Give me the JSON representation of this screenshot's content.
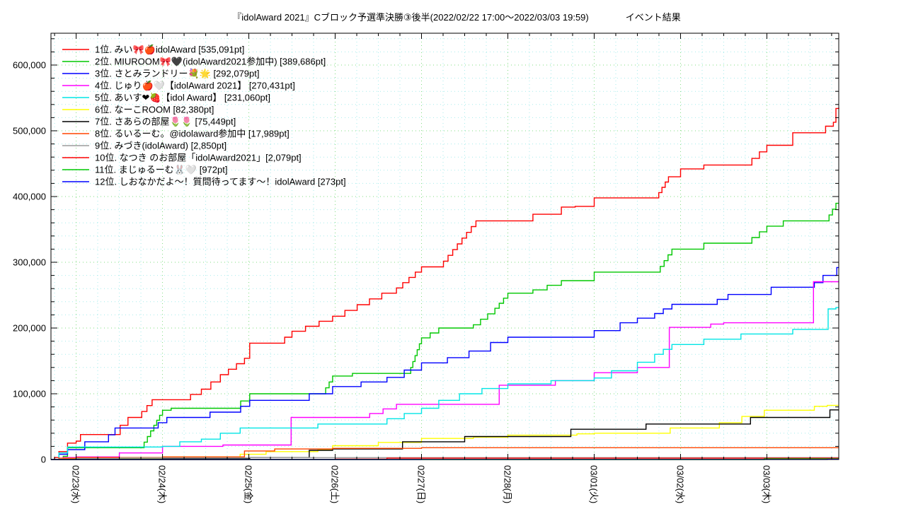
{
  "title": "『idolAward 2021』Cブロック予選準決勝③後半(2022/02/22 17:00～2022/03/03 19:59)　　　　イベント結果",
  "chart_data": {
    "type": "line",
    "title": "『idolAward 2021』Cブロック予選準決勝③後半(2022/02/22 17:00～2022/03/03 19:59) イベント結果",
    "xlabel": "",
    "ylabel": "",
    "legend_position": "upper-left-inside",
    "grid": {
      "major_color": "#82dc82",
      "minor_color": "#a6ebeb",
      "style": "dotted"
    },
    "x_axis": {
      "unit": "days_from_2022-02-22",
      "start_day": 0.7083,
      "end_day": 9.8326,
      "minor_step_days": 0.25,
      "ticks": [
        {
          "day": 1,
          "label": "02/23(水)"
        },
        {
          "day": 2,
          "label": "02/24(木)"
        },
        {
          "day": 3,
          "label": "02/25(金)"
        },
        {
          "day": 4,
          "label": "02/26(土)"
        },
        {
          "day": 5,
          "label": "02/27(日)"
        },
        {
          "day": 6,
          "label": "02/28(月)"
        },
        {
          "day": 7,
          "label": "03/01(火)"
        },
        {
          "day": 8,
          "label": "03/02(水)"
        },
        {
          "day": 9,
          "label": "03/03(木)"
        }
      ]
    },
    "y_axis": {
      "min": 0,
      "max": 600000,
      "major_step": 100000,
      "minor_step": 20000,
      "tick_labels": [
        "0",
        "100,000",
        "200,000",
        "300,000",
        "400,000",
        "500,000",
        "600,000"
      ]
    },
    "series": [
      {
        "rank": 1,
        "label": " 1位. みい🎀🍎idolAward [535,091pt]",
        "final_pt": 535091,
        "color": "#ff0000",
        "points": [
          [
            0.708,
            0
          ],
          [
            0.75,
            3000
          ],
          [
            0.8,
            12000
          ],
          [
            0.9,
            25000
          ],
          [
            1.0,
            28000
          ],
          [
            1.05,
            38000
          ],
          [
            1.45,
            38000
          ],
          [
            1.51,
            52000
          ],
          [
            1.6,
            64000
          ],
          [
            1.7,
            64000
          ],
          [
            1.88,
            91000
          ],
          [
            2.2,
            91000
          ],
          [
            2.45,
            107000
          ],
          [
            2.67,
            129000
          ],
          [
            2.95,
            154000
          ],
          [
            3.01,
            177000
          ],
          [
            3.33,
            177000
          ],
          [
            3.5,
            195000
          ],
          [
            3.97,
            218000
          ],
          [
            4.54,
            253000
          ],
          [
            4.71,
            261000
          ],
          [
            5.0,
            293000
          ],
          [
            5.2,
            293000
          ],
          [
            5.63,
            363000
          ],
          [
            6.13,
            363000
          ],
          [
            6.29,
            373000
          ],
          [
            6.62,
            384000
          ],
          [
            6.78,
            385000
          ],
          [
            7.0,
            398000
          ],
          [
            7.71,
            398000
          ],
          [
            7.86,
            430000
          ],
          [
            8.0,
            442000
          ],
          [
            8.27,
            448000
          ],
          [
            8.74,
            448000
          ],
          [
            9.0,
            478000
          ],
          [
            9.27,
            478000
          ],
          [
            9.3,
            497000
          ],
          [
            9.65,
            497000
          ],
          [
            9.68,
            507000
          ],
          [
            9.77,
            513000
          ],
          [
            9.8,
            534000
          ],
          [
            9.8326,
            535091
          ]
        ]
      },
      {
        "rank": 2,
        "label": " 2位. MIUROOM🎀🖤(idolAward2021参加中) [389,686pt]",
        "final_pt": 389686,
        "color": "#00c800",
        "points": [
          [
            0.708,
            0
          ],
          [
            0.85,
            5000
          ],
          [
            0.9,
            18000
          ],
          [
            1.75,
            18000
          ],
          [
            1.9,
            52000
          ],
          [
            2.0,
            75000
          ],
          [
            2.1,
            78000
          ],
          [
            2.8,
            78000
          ],
          [
            3.01,
            100000
          ],
          [
            3.85,
            100000
          ],
          [
            3.97,
            127000
          ],
          [
            4.2,
            131000
          ],
          [
            4.85,
            131000
          ],
          [
            5.0,
            185000
          ],
          [
            5.2,
            200000
          ],
          [
            5.6,
            205000
          ],
          [
            5.85,
            230000
          ],
          [
            6.0,
            253000
          ],
          [
            6.29,
            258000
          ],
          [
            6.62,
            272000
          ],
          [
            7.0,
            285000
          ],
          [
            7.72,
            285000
          ],
          [
            7.9,
            320000
          ],
          [
            8.27,
            329000
          ],
          [
            8.74,
            329000
          ],
          [
            9.0,
            355000
          ],
          [
            9.19,
            363000
          ],
          [
            9.68,
            363000
          ],
          [
            9.8,
            389686
          ],
          [
            9.8326,
            389686
          ]
        ]
      },
      {
        "rank": 3,
        "label": " 3位. さとみランドリー💐🌟 [292,079pt]",
        "final_pt": 292079,
        "color": "#0000ff",
        "points": [
          [
            0.708,
            0
          ],
          [
            0.8,
            8000
          ],
          [
            0.9,
            15000
          ],
          [
            1.05,
            15000
          ],
          [
            1.1,
            27000
          ],
          [
            1.3,
            27000
          ],
          [
            1.45,
            48000
          ],
          [
            1.85,
            48000
          ],
          [
            2.05,
            64000
          ],
          [
            2.4,
            64000
          ],
          [
            2.55,
            72000
          ],
          [
            2.8,
            72000
          ],
          [
            3.01,
            90000
          ],
          [
            3.5,
            90000
          ],
          [
            3.7,
            100000
          ],
          [
            3.97,
            111000
          ],
          [
            4.3,
            118000
          ],
          [
            4.6,
            125000
          ],
          [
            5.0,
            147000
          ],
          [
            5.3,
            155000
          ],
          [
            5.55,
            165000
          ],
          [
            5.8,
            178000
          ],
          [
            6.0,
            186000
          ],
          [
            6.6,
            186000
          ],
          [
            7.0,
            196000
          ],
          [
            7.3,
            208000
          ],
          [
            7.7,
            222000
          ],
          [
            7.9,
            236000
          ],
          [
            8.3,
            236000
          ],
          [
            8.55,
            251000
          ],
          [
            8.9,
            251000
          ],
          [
            9.05,
            262000
          ],
          [
            9.45,
            262000
          ],
          [
            9.55,
            269000
          ],
          [
            9.65,
            280000
          ],
          [
            9.78,
            280000
          ],
          [
            9.81,
            292079
          ],
          [
            9.8326,
            292079
          ]
        ]
      },
      {
        "rank": 4,
        "label": " 4位. じゅり🍎🤍【idolAward 2021】 [270,431pt]",
        "final_pt": 270431,
        "color": "#ff00ff",
        "points": [
          [
            0.708,
            0
          ],
          [
            0.85,
            3000
          ],
          [
            1.0,
            4000
          ],
          [
            1.3,
            4000
          ],
          [
            1.5,
            10000
          ],
          [
            1.95,
            10000
          ],
          [
            2.0,
            20000
          ],
          [
            2.6,
            20000
          ],
          [
            2.7,
            22000
          ],
          [
            3.45,
            22000
          ],
          [
            3.49,
            64000
          ],
          [
            4.4,
            70000
          ],
          [
            4.71,
            84000
          ],
          [
            5.85,
            84000
          ],
          [
            5.9,
            113000
          ],
          [
            6.4,
            113000
          ],
          [
            6.55,
            120000
          ],
          [
            7.0,
            132000
          ],
          [
            7.5,
            140000
          ],
          [
            7.85,
            140000
          ],
          [
            7.87,
            201000
          ],
          [
            8.35,
            206000
          ],
          [
            8.5,
            208000
          ],
          [
            9.51,
            208000
          ],
          [
            9.54,
            270431
          ],
          [
            9.8326,
            270431
          ]
        ]
      },
      {
        "rank": 5,
        "label": " 5位. あいす❤🍓【idol Award】 [231,060pt]",
        "final_pt": 231060,
        "color": "#00e5e5",
        "points": [
          [
            0.708,
            0
          ],
          [
            0.8,
            10000
          ],
          [
            0.9,
            19000
          ],
          [
            2.0,
            20000
          ],
          [
            2.2,
            27000
          ],
          [
            2.45,
            31000
          ],
          [
            2.67,
            40000
          ],
          [
            2.9,
            48000
          ],
          [
            3.6,
            48000
          ],
          [
            3.8,
            54000
          ],
          [
            4.4,
            54000
          ],
          [
            4.6,
            62000
          ],
          [
            4.8,
            70000
          ],
          [
            5.0,
            78000
          ],
          [
            5.2,
            90000
          ],
          [
            5.44,
            100000
          ],
          [
            5.7,
            108000
          ],
          [
            6.0,
            115000
          ],
          [
            6.5,
            120000
          ],
          [
            7.0,
            124000
          ],
          [
            7.2,
            135000
          ],
          [
            7.5,
            148000
          ],
          [
            7.7,
            160000
          ],
          [
            7.9,
            175000
          ],
          [
            8.27,
            183000
          ],
          [
            8.7,
            191000
          ],
          [
            9.3,
            198000
          ],
          [
            9.68,
            198000
          ],
          [
            9.71,
            229000
          ],
          [
            9.8,
            231060
          ],
          [
            9.8326,
            231060
          ]
        ]
      },
      {
        "rank": 6,
        "label": " 6位. なーこROOM [82,380pt]",
        "final_pt": 82380,
        "color": "#ffff00",
        "points": [
          [
            0.708,
            0
          ],
          [
            0.85,
            1500
          ],
          [
            1.0,
            2000
          ],
          [
            2.0,
            4000
          ],
          [
            2.9,
            8000
          ],
          [
            3.2,
            12000
          ],
          [
            3.8,
            15000
          ],
          [
            3.97,
            21000
          ],
          [
            4.5,
            26000
          ],
          [
            5.0,
            32000
          ],
          [
            5.6,
            34000
          ],
          [
            6.0,
            37000
          ],
          [
            6.8,
            39000
          ],
          [
            7.0,
            40000
          ],
          [
            7.88,
            48000
          ],
          [
            8.45,
            56000
          ],
          [
            8.97,
            75000
          ],
          [
            9.55,
            81000
          ],
          [
            9.7,
            82380
          ],
          [
            9.8326,
            82380
          ]
        ]
      },
      {
        "rank": 7,
        "label": " 7位. さあらの部屋🌷🌷 [75,449pt]",
        "final_pt": 75449,
        "color": "#000000",
        "points": [
          [
            0.708,
            0
          ],
          [
            1.0,
            500
          ],
          [
            2.0,
            1000
          ],
          [
            3.01,
            3000
          ],
          [
            3.7,
            14000
          ],
          [
            3.97,
            16000
          ],
          [
            4.78,
            27000
          ],
          [
            5.48,
            27000
          ],
          [
            5.5,
            35000
          ],
          [
            6.7,
            35000
          ],
          [
            6.73,
            46000
          ],
          [
            7.55,
            46000
          ],
          [
            7.6,
            54000
          ],
          [
            8.78,
            54000
          ],
          [
            8.81,
            64000
          ],
          [
            9.7,
            64000
          ],
          [
            9.73,
            75449
          ],
          [
            9.8326,
            75449
          ]
        ]
      },
      {
        "rank": 8,
        "label": " 8位. るいるーむ。@idolaward参加中 [17,989pt]",
        "final_pt": 17989,
        "color": "#ff4500",
        "points": [
          [
            0.708,
            0
          ],
          [
            0.8,
            2000
          ],
          [
            1.0,
            3000
          ],
          [
            2.0,
            4000
          ],
          [
            2.9,
            4000
          ],
          [
            2.95,
            13000
          ],
          [
            3.3,
            16000
          ],
          [
            3.97,
            17000
          ],
          [
            5.0,
            17989
          ],
          [
            9.8326,
            17989
          ]
        ]
      },
      {
        "rank": 9,
        "label": " 9位. みづき(idolAward) [2,850pt]",
        "final_pt": 2850,
        "color": "#9b9b9b",
        "points": [
          [
            0.708,
            0
          ],
          [
            1.0,
            1500
          ],
          [
            1.5,
            2500
          ],
          [
            3.0,
            2850
          ],
          [
            9.8326,
            2850
          ]
        ]
      },
      {
        "rank": 10,
        "label": "10位. なつき のお部屋「idolAward2021」[2,079pt]",
        "final_pt": 2079,
        "color": "#ff0000",
        "points": [
          [
            0.708,
            0
          ],
          [
            3.0,
            300
          ],
          [
            4.0,
            800
          ],
          [
            4.6,
            2000
          ],
          [
            5.0,
            2079
          ],
          [
            9.8326,
            2079
          ]
        ]
      },
      {
        "rank": 11,
        "label": "11位. まじゅるーむ🐰🤍 [972pt]",
        "final_pt": 972,
        "color": "#00c800",
        "points": [
          [
            0.708,
            0
          ],
          [
            8.9,
            0
          ],
          [
            8.97,
            972
          ],
          [
            9.8326,
            972
          ]
        ]
      },
      {
        "rank": 12,
        "label": "12位. しおなかだよ～！質問待ってます～！idolAward [273pt]",
        "final_pt": 273,
        "color": "#0000ff",
        "points": [
          [
            0.708,
            0
          ],
          [
            5.0,
            100
          ],
          [
            9.5,
            150
          ],
          [
            9.7,
            273
          ],
          [
            9.8326,
            273
          ]
        ]
      }
    ]
  }
}
